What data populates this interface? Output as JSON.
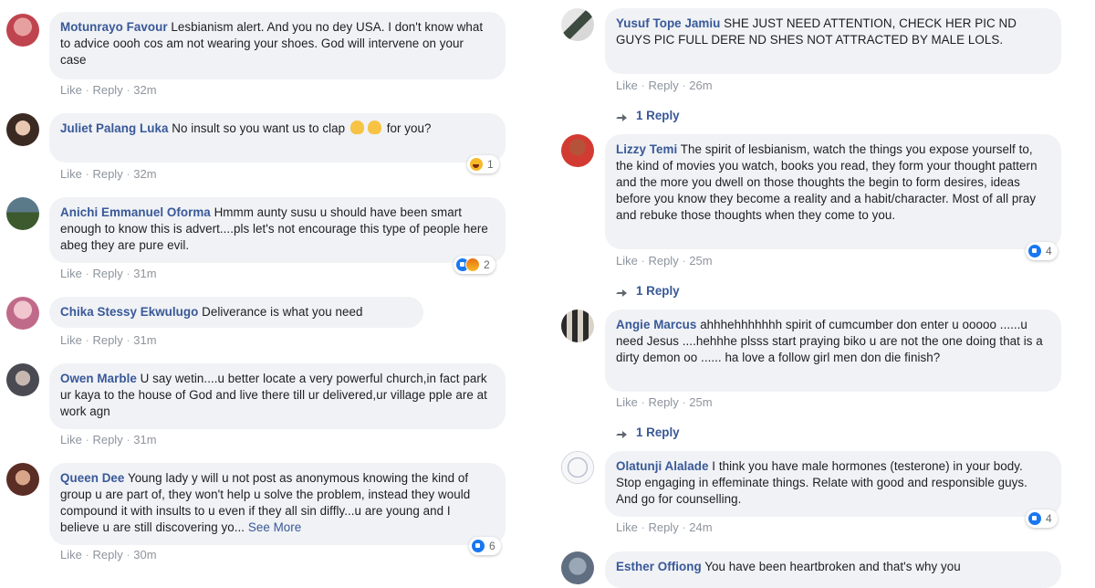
{
  "actions": {
    "like": "Like",
    "reply": "Reply",
    "separator": "·"
  },
  "left": [
    {
      "author": "Motunrayo Favour",
      "text": "Lesbianism alert. And you no dey USA. I don't know what to advice oooh cos am not wearing your shoes. God will intervene on your case",
      "time": "32m"
    },
    {
      "author": "Juliet Palang Luka",
      "text_before": "No insult so you want us to clap",
      "text_after": "for you?",
      "time": "32m",
      "reaction_count": "1",
      "reaction_icons": [
        "haha-icon"
      ]
    },
    {
      "author": "Anichi Emmanuel Oforma",
      "text": "Hmmm aunty susu u should have been smart enough to know this is advert....pls let's not encourage this type of people here abeg they are pure evil.",
      "time": "31m",
      "reaction_count": "2",
      "reaction_icons": [
        "like-icon",
        "angry-icon"
      ]
    },
    {
      "author": "Chika Stessy Ekwulugo",
      "text": "Deliverance is what you need",
      "time": "31m"
    },
    {
      "author": "Owen Marble",
      "text": "U say wetin....u better locate a very powerful church,in fact park ur kaya to the house of God and live there till ur delivered,ur village pple are at work agn",
      "time": "31m"
    },
    {
      "author": "Queen Dee",
      "text": "Young lady y will u not post as anonymous knowing the kind of group u are part of, they won't help u solve the problem, instead they would compound it with insults to u even if they all sin diffly...u are young and I believe u are still discovering yo...",
      "see_more": "See More",
      "time": "30m",
      "reaction_count": "6",
      "reaction_icons": [
        "like-icon"
      ]
    }
  ],
  "right": [
    {
      "author": "Yusuf Tope Jamiu",
      "text": "SHE JUST NEED ATTENTION, CHECK HER PIC ND GUYS PIC FULL DERE ND SHES NOT ATTRACTED BY MALE LOLS.",
      "time": "26m",
      "replies": "1 Reply"
    },
    {
      "author": "Lizzy Temi",
      "text": "The spirit of lesbianism, watch the things you expose yourself to, the kind of movies you watch, books you read, they form your thought pattern and the more you dwell on those thoughts the begin to form desires, ideas before you know they become a reality and a habit/character. Most of all pray and rebuke those thoughts when they come to you.",
      "time": "25m",
      "reaction_count": "4",
      "reaction_icons": [
        "like-icon"
      ],
      "replies": "1 Reply"
    },
    {
      "author": "Angie Marcus",
      "text": "ahhhehhhhhhh spirit of cumcumber don enter u ooooo ......u need Jesus ....hehhhe plsss start praying biko u are not the one doing that is a dirty demon oo ...... ha love a follow girl men don die finish?",
      "time": "25m",
      "replies": "1 Reply"
    },
    {
      "author": "Olatunji Alalade",
      "text": "I think you have male hormones (testerone) in your body. Stop engaging in effeminate things. Relate with good and responsible guys. And go for counselling.",
      "time": "24m",
      "reaction_count": "4",
      "reaction_icons": [
        "like-icon"
      ]
    },
    {
      "author": "Esther Offiong",
      "text": "You have been heartbroken and that's why you",
      "time": ""
    }
  ]
}
